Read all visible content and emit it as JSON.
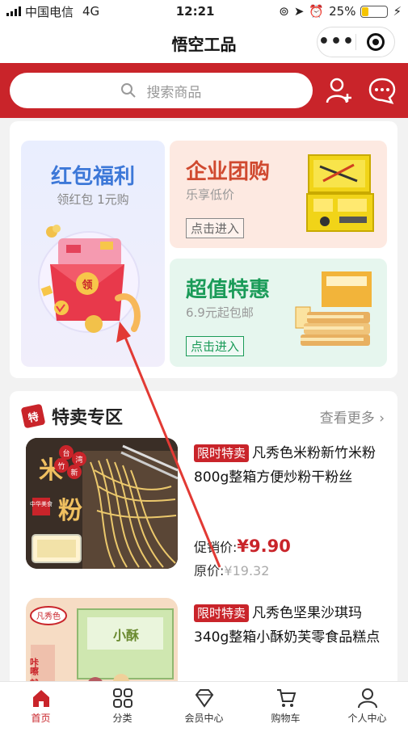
{
  "status": {
    "carrier": "中国电信",
    "network": "4G",
    "time": "12:21",
    "battery": "25%",
    "battery_level": 0.25
  },
  "navbar": {
    "title": "悟空工品",
    "more_icon": "ellipsis-icon",
    "close_icon": "target-icon"
  },
  "search": {
    "placeholder": "搜索商品"
  },
  "promo": {
    "redpacket": {
      "title": "红包福利",
      "subtitle": "领红包 1元购",
      "badge": "领"
    },
    "enterprise": {
      "title": "企业团购",
      "subtitle": "乐享低价",
      "enter": "点击进入"
    },
    "deal": {
      "title": "超值特惠",
      "subtitle": "6.9元起包邮",
      "enter": "点击进入"
    }
  },
  "sale": {
    "tag": "特",
    "title": "特卖专区",
    "more": "查看更多 ›",
    "products": [
      {
        "badge": "限时特卖",
        "name": "凡秀色米粉新竹米粉800g整箱方便炒粉干粉丝",
        "sale_label": "促销价:",
        "sale_price": "¥9.90",
        "orig_label": "原价:",
        "orig_price": "¥19.32",
        "img_text": [
          "米",
          "粉"
        ],
        "img_tag": [
          "台",
          "湾",
          "新",
          "竹"
        ],
        "img_sub": "中华美食"
      },
      {
        "badge": "限时特卖",
        "name": "凡秀色坚果沙琪玛340g整箱小酥奶芙零食品糕点",
        "img_brand": "凡秀色",
        "img_side": "咔嚓 就是这",
        "img_box": "小酥"
      }
    ]
  },
  "tabs": [
    {
      "label": "首页",
      "icon": "home-icon",
      "active": true
    },
    {
      "label": "分类",
      "icon": "grid-icon",
      "active": false
    },
    {
      "label": "会员中心",
      "icon": "diamond-icon",
      "active": false
    },
    {
      "label": "购物车",
      "icon": "cart-icon",
      "active": false
    },
    {
      "label": "个人中心",
      "icon": "user-icon",
      "active": false
    }
  ],
  "colors": {
    "brand": "#c9242a",
    "blue": "#3d78d8",
    "green": "#1a9b58"
  }
}
